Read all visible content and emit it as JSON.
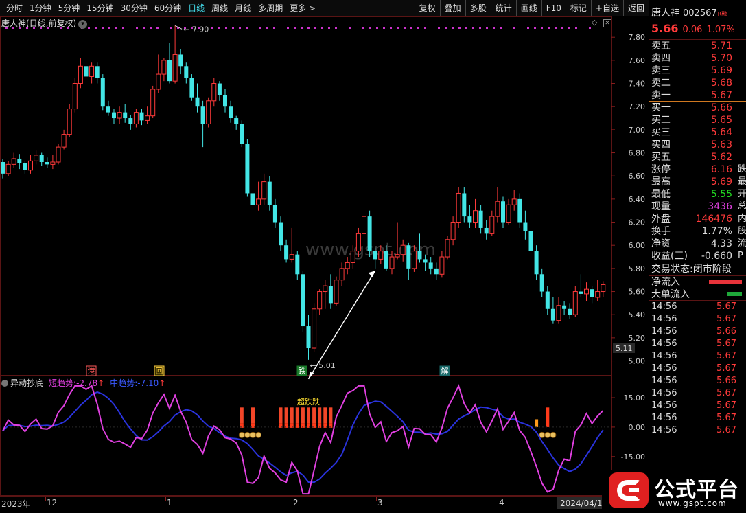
{
  "toolbar": {
    "periods": [
      "分时",
      "1分钟",
      "5分钟",
      "15分钟",
      "30分钟",
      "60分钟",
      "日线",
      "周线",
      "月线",
      "多周期",
      "更多 >"
    ],
    "active_period": "日线",
    "tools": [
      "复权",
      "叠加",
      "多股",
      "统计",
      "画线",
      "F10",
      "标记",
      "+自选",
      "返回"
    ]
  },
  "chart": {
    "title": "唐人神(日线,前复权)",
    "watermark": "www.gspt.com",
    "high_label": "7.90",
    "low_label": "5.01",
    "price_tag": "5.11",
    "markers": [
      {
        "text": "港",
        "color": "#ff5a5a"
      },
      {
        "text": "回",
        "color": "#ffd040"
      },
      {
        "text": "跌",
        "color": "#ffffff"
      },
      {
        "text": "解",
        "color": "#ffffff"
      }
    ],
    "signal_label": "超跌跌",
    "indicator": {
      "name": "异动抄底",
      "short_label": "短趋势:",
      "short_value": "-2.78",
      "mid_label": "中趋势:",
      "mid_value": "-7.10"
    },
    "dates": [
      "2023年",
      "12",
      "1",
      "2",
      "3",
      "4"
    ],
    "current_date": "2024/04/18/四"
  },
  "chart_data": {
    "type": "candlestick",
    "price_axis": {
      "ticks": [
        7.8,
        7.6,
        7.4,
        7.2,
        7.0,
        6.8,
        6.6,
        6.4,
        6.2,
        6.0,
        5.8,
        5.6,
        5.4,
        5.2,
        5.0
      ],
      "range": [
        4.92,
        7.92
      ]
    },
    "candles": [
      [
        6.72,
        6.62,
        6.75,
        6.58
      ],
      [
        6.62,
        6.7,
        6.73,
        6.6
      ],
      [
        6.7,
        6.75,
        6.8,
        6.67
      ],
      [
        6.75,
        6.71,
        6.79,
        6.66
      ],
      [
        6.71,
        6.65,
        6.73,
        6.62
      ],
      [
        6.65,
        6.73,
        6.78,
        6.62
      ],
      [
        6.73,
        6.78,
        6.82,
        6.7
      ],
      [
        6.78,
        6.72,
        6.8,
        6.69
      ],
      [
        6.72,
        6.7,
        6.76,
        6.67
      ],
      [
        6.7,
        6.72,
        6.78,
        6.66
      ],
      [
        6.72,
        6.85,
        6.88,
        6.7
      ],
      [
        6.85,
        6.96,
        7.0,
        6.83
      ],
      [
        6.96,
        7.18,
        7.22,
        6.94
      ],
      [
        7.18,
        7.4,
        7.45,
        7.15
      ],
      [
        7.4,
        7.55,
        7.62,
        7.36
      ],
      [
        7.55,
        7.46,
        7.6,
        7.4
      ],
      [
        7.46,
        7.55,
        7.58,
        7.4
      ],
      [
        7.55,
        7.45,
        7.58,
        7.4
      ],
      [
        7.45,
        7.2,
        7.48,
        7.17
      ],
      [
        7.2,
        7.15,
        7.25,
        7.12
      ],
      [
        7.15,
        7.1,
        7.18,
        7.05
      ],
      [
        7.1,
        7.15,
        7.2,
        7.05
      ],
      [
        7.15,
        7.1,
        7.22,
        7.06
      ],
      [
        7.1,
        7.05,
        7.13,
        7.0
      ],
      [
        7.05,
        7.15,
        7.18,
        7.02
      ],
      [
        7.15,
        7.08,
        7.18,
        7.04
      ],
      [
        7.08,
        7.12,
        7.2,
        7.05
      ],
      [
        7.12,
        7.35,
        7.38,
        7.1
      ],
      [
        7.35,
        7.48,
        7.65,
        7.32
      ],
      [
        7.48,
        7.6,
        7.62,
        7.42
      ],
      [
        7.6,
        7.42,
        7.75,
        7.4
      ],
      [
        7.42,
        7.65,
        7.9,
        7.4
      ],
      [
        7.65,
        7.55,
        7.7,
        7.48
      ],
      [
        7.55,
        7.45,
        7.58,
        7.4
      ],
      [
        7.45,
        7.28,
        7.48,
        7.25
      ],
      [
        7.28,
        7.2,
        7.4,
        7.15
      ],
      [
        7.2,
        7.05,
        7.25,
        6.85
      ],
      [
        7.05,
        7.25,
        7.28,
        7.02
      ],
      [
        7.25,
        7.4,
        7.45,
        7.2
      ],
      [
        7.4,
        7.3,
        7.42,
        7.25
      ],
      [
        7.3,
        7.2,
        7.35,
        7.15
      ],
      [
        7.2,
        7.1,
        7.25,
        7.06
      ],
      [
        7.1,
        7.05,
        7.12,
        7.0
      ],
      [
        7.05,
        6.88,
        7.08,
        6.85
      ],
      [
        6.88,
        6.45,
        6.92,
        6.42
      ],
      [
        6.45,
        6.35,
        6.5,
        6.2
      ],
      [
        6.35,
        6.4,
        6.55,
        6.3
      ],
      [
        6.4,
        6.55,
        6.62,
        6.35
      ],
      [
        6.55,
        6.35,
        6.6,
        6.3
      ],
      [
        6.35,
        6.2,
        6.4,
        6.15
      ],
      [
        6.2,
        6.0,
        6.25,
        5.95
      ],
      [
        6.0,
        5.88,
        6.05,
        5.85
      ],
      [
        5.88,
        5.92,
        6.15,
        5.85
      ],
      [
        5.92,
        5.75,
        5.95,
        5.7
      ],
      [
        5.75,
        5.3,
        5.78,
        5.25
      ],
      [
        5.3,
        5.11,
        5.4,
        5.01
      ],
      [
        5.11,
        5.45,
        5.5,
        5.08
      ],
      [
        5.45,
        5.6,
        5.62,
        5.4
      ],
      [
        5.6,
        5.65,
        5.7,
        5.45
      ],
      [
        5.65,
        5.5,
        5.75,
        5.45
      ],
      [
        5.5,
        5.7,
        5.73,
        5.48
      ],
      [
        5.7,
        5.8,
        5.85,
        5.65
      ],
      [
        5.8,
        5.85,
        5.9,
        5.75
      ],
      [
        5.85,
        5.95,
        6.0,
        5.8
      ],
      [
        5.95,
        6.1,
        6.15,
        5.9
      ],
      [
        6.1,
        6.25,
        6.3,
        6.05
      ],
      [
        6.25,
        5.95,
        6.3,
        5.9
      ],
      [
        5.95,
        5.88,
        5.98,
        5.8
      ],
      [
        5.88,
        5.95,
        6.0,
        5.84
      ],
      [
        5.95,
        5.8,
        6.0,
        5.78
      ],
      [
        5.8,
        5.9,
        5.95,
        5.75
      ],
      [
        5.9,
        5.92,
        6.2,
        5.88
      ],
      [
        5.92,
        6.0,
        6.05,
        5.86
      ],
      [
        6.0,
        5.8,
        6.02,
        5.7
      ],
      [
        5.8,
        5.95,
        6.0,
        5.77
      ],
      [
        5.95,
        5.88,
        6.1,
        5.85
      ],
      [
        5.88,
        5.85,
        5.92,
        5.78
      ],
      [
        5.85,
        5.8,
        5.9,
        5.75
      ],
      [
        5.8,
        5.75,
        5.85,
        5.7
      ],
      [
        5.75,
        5.9,
        5.95,
        5.72
      ],
      [
        5.9,
        6.05,
        6.08,
        5.88
      ],
      [
        6.05,
        6.2,
        6.25,
        6.0
      ],
      [
        6.2,
        6.45,
        6.5,
        6.15
      ],
      [
        6.45,
        6.25,
        6.5,
        6.2
      ],
      [
        6.25,
        6.2,
        6.35,
        6.15
      ],
      [
        6.2,
        6.3,
        6.4,
        6.15
      ],
      [
        6.3,
        6.15,
        6.35,
        6.1
      ],
      [
        6.15,
        6.1,
        6.22,
        6.05
      ],
      [
        6.1,
        6.25,
        6.3,
        6.08
      ],
      [
        6.25,
        6.38,
        6.5,
        6.2
      ],
      [
        6.38,
        6.2,
        6.42,
        6.15
      ],
      [
        6.2,
        6.35,
        6.4,
        6.18
      ],
      [
        6.35,
        6.4,
        6.48,
        6.3
      ],
      [
        6.4,
        6.2,
        6.45,
        6.15
      ],
      [
        6.2,
        6.12,
        6.3,
        6.05
      ],
      [
        6.12,
        5.95,
        6.2,
        5.9
      ],
      [
        5.95,
        5.75,
        6.0,
        5.7
      ],
      [
        5.75,
        5.6,
        5.8,
        5.55
      ],
      [
        5.6,
        5.45,
        5.65,
        5.4
      ],
      [
        5.45,
        5.35,
        5.55,
        5.32
      ],
      [
        5.35,
        5.48,
        5.55,
        5.32
      ],
      [
        5.48,
        5.45,
        5.52,
        5.4
      ],
      [
        5.45,
        5.4,
        5.5,
        5.36
      ],
      [
        5.4,
        5.6,
        5.65,
        5.38
      ],
      [
        5.6,
        5.58,
        5.75,
        5.55
      ],
      [
        5.58,
        5.62,
        5.68,
        5.52
      ],
      [
        5.62,
        5.55,
        5.65,
        5.5
      ],
      [
        5.55,
        5.6,
        5.7,
        5.52
      ],
      [
        5.6,
        5.66,
        5.69,
        5.55
      ]
    ],
    "indicator_axis": {
      "ticks": [
        15.0,
        0.0,
        -15.0
      ],
      "range": [
        -35,
        22
      ]
    },
    "series": [
      {
        "name": "短趋势",
        "color": "#e040e0"
      },
      {
        "name": "中趋势",
        "color": "#2a33dd"
      }
    ],
    "signals": {
      "count": 3,
      "weak_count": 1
    }
  },
  "quote": {
    "name": "唐人神",
    "code": "002567",
    "flag": "R融",
    "price": "5.66",
    "change": "0.06",
    "change_pct": "1.07%",
    "asks": [
      {
        "label": "卖五",
        "price": "5.71"
      },
      {
        "label": "卖四",
        "price": "5.70"
      },
      {
        "label": "卖三",
        "price": "5.69"
      },
      {
        "label": "卖二",
        "price": "5.68"
      },
      {
        "label": "卖一",
        "price": "5.67"
      }
    ],
    "bids": [
      {
        "label": "买一",
        "price": "5.66"
      },
      {
        "label": "买二",
        "price": "5.65"
      },
      {
        "label": "买三",
        "price": "5.64"
      },
      {
        "label": "买四",
        "price": "5.63"
      },
      {
        "label": "买五",
        "price": "5.62"
      }
    ],
    "stats": [
      {
        "label": "涨停",
        "value": "6.16",
        "color": "#ff3a3a",
        "extra": "跌"
      },
      {
        "label": "最高",
        "value": "5.69",
        "color": "#ff3a3a",
        "extra": "最"
      },
      {
        "label": "最低",
        "value": "5.55",
        "color": "#22dd22",
        "extra": "开"
      },
      {
        "label": "现量",
        "value": "3436",
        "color": "#e040e0",
        "extra": "总"
      },
      {
        "label": "外盘",
        "value": "146476",
        "color": "#ff3a3a",
        "extra": "内"
      }
    ],
    "fund": [
      {
        "label": "换手",
        "value": "1.77%",
        "color": "#dddddd",
        "extra": "股"
      },
      {
        "label": "净资",
        "value": "4.33",
        "color": "#dddddd",
        "extra": "流"
      },
      {
        "label": "收益(三)",
        "value": "-0.660",
        "color": "#dddddd",
        "extra": "P"
      }
    ],
    "state_label": "交易状态:",
    "state_value": "闭市阶段",
    "flows": [
      {
        "label": "净流入",
        "color": "#e8333a",
        "width": 48
      },
      {
        "label": "大单流入",
        "color": "#1fa83a",
        "width": 22
      }
    ],
    "ticks": [
      {
        "time": "14:56",
        "price": "5.67"
      },
      {
        "time": "14:56",
        "price": "5.67"
      },
      {
        "time": "14:56",
        "price": "5.66"
      },
      {
        "time": "14:56",
        "price": "5.67"
      },
      {
        "time": "14:56",
        "price": "5.67"
      },
      {
        "time": "14:56",
        "price": "5.67"
      },
      {
        "time": "14:56",
        "price": "5.66"
      },
      {
        "time": "14:56",
        "price": "5.67"
      },
      {
        "time": "14:56",
        "price": "5.67"
      },
      {
        "time": "14:56",
        "price": "5.67"
      },
      {
        "time": "14:56",
        "price": "5.67"
      }
    ]
  },
  "logo": {
    "text": "公式平台",
    "url": "www.gspt.com"
  }
}
